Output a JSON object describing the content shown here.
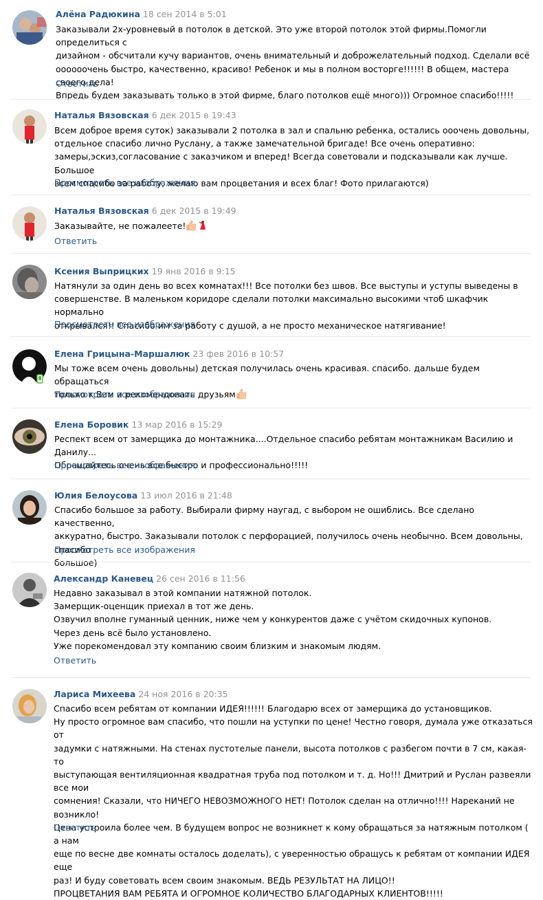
{
  "reviews": [
    {
      "author": "Алёна Радюкина",
      "date": "18 сен 2014 в 5:01",
      "lines": [
        "Заказывали 2х-уровневый в потолок в детской. Это уже второй потолок этой фирмы.Помогли определиться с",
        "дизайном - обсчитали кучу вариантов, очень внимательный и доброжелательный подход. Сделали всё",
        "оооооочень быстро, качественно, красиво! Ребенок и мы в полном восторге!!!!!! В общем, мастера своего дела!",
        "Впредь будем заказывать только в этой фирме, благо потолков ещё много))) Огромное спасибо!!!!!"
      ],
      "action": "Ответить"
    },
    {
      "author": "Наталья Вязовская",
      "date": "6 дек 2015 в 19:43",
      "lines": [
        "Всем доброе время суток) заказывали 2 потолка в зал и спальню ребенка, остались ооочень довольны,",
        "отдельное спасибо лично Руслану, а также замечательной бригаде! Все очень оперативно:",
        "замеры,эскиз,согласование с заказчиком и вперед! Всегда советовали и подсказывали как лучше. Большое",
        "всем спасибо за работу, желаю вам процветания и всех благ! Фото прилагаются)"
      ],
      "action": "Просмотреть все изображения"
    },
    {
      "author": "Наталья Вязовская",
      "date": "6 дек 2015 в 19:49",
      "lines": [
        "Заказывайте, не пожалеете!"
      ],
      "emojis": [
        "thumbs-up-emoji",
        "dancer-emoji"
      ],
      "action": "Ответить"
    },
    {
      "author": "Ксения Выприцких",
      "date": "19 янв 2016 в 9:15",
      "lines": [
        "Натянули за один день во всех комнатах!!! Все потолки без швов. Все выступы и уступы выведены в",
        "совершенстве. В маленьком коридоре сделали потолки максимально высокими чтоб шкафчик нормально",
        "открывался!! Спасибо им за работу с душой, а не просто механическое натягивание!"
      ],
      "action": "Просмотреть все изображения"
    },
    {
      "author": "Елена Грицына-Маршалюк",
      "date": "23 фев 2016 в 10:57",
      "lines": [
        "Мы тоже всем очень довольны) детская получилась очень красивая. спасибо. дальше будем обращаться",
        "только к Вам и рекомендовать друзьям"
      ],
      "emojis": [
        "thumbs-up-emoji"
      ],
      "action": "Просмотреть все изображения"
    },
    {
      "author": "Елена Боровик",
      "date": "13 мар 2016 в 15:29",
      "lines": [
        "Респект всем от замерщика до монтажника....Отдельное спасибо ребятам монтажникам Василию и Данилу...",
        "Обращайтесь очень все быстро и профессионально!!!!!"
      ],
      "action": "Просмотреть все изображения"
    },
    {
      "author": "Юлия Белоусова",
      "date": "13 июл 2016 в 21:48",
      "lines": [
        "Спасибо большое за работу. Выбирали фирму наугад, с выбором не ошиблись. Все сделано качественно,",
        "аккуратно, быстро. Заказывали потолок с перфорацией, получилось очень необычно. Всем довольны, спасибо",
        "большое)"
      ],
      "action": "Просмотреть все изображения"
    },
    {
      "author": "Александр Каневец",
      "date": "26 сен 2016 в 11:56",
      "lines": [
        "Недавно заказывал в этой компании натяжной потолок.",
        "Замерщик-оценщик приехал в тот же день.",
        "Озвучил вполне гуманный ценник, ниже чем у конкурентов даже с учётом скидочных купонов.",
        "Через день всё было установлено.",
        "Уже порекомендовал эту компанию своим близким и знакомым людям."
      ],
      "action": "Ответить"
    },
    {
      "author": "Лариса Михеева",
      "date": "24 ноя 2016 в 20:35",
      "lines": [
        "Спасибо всем ребятам от компании ИДЕЯ!!!!!! Благодарю всех от замерщика до установщиков.",
        "Ну просто огромное вам спасибо, что пошли на уступки по цене! Честно говоря, думала уже отказаться от",
        "задумки с натяжными. На стенах пустотелые панели, высота потолков с разбегом почти в 7 см, какая-то",
        "выступающая вентиляционная квадратная труба под потолком и т. д. Но!!! Дмитрий и Руслан развеяли все мои",
        "сомнения! Сказали, что НИЧЕГО НЕВОЗМОЖНОГО НЕТ! Потолок сделан на отлично!!!! Нареканий не возникло!",
        "Цена устроила более чем. В будущем вопрос не возникнет к кому обращаться за натяжным потолком ( а нам",
        "еще по весне две комнаты осталось доделать), с уверенностью обращусь к ребятам от компании ИДЕЯ еще",
        "раз! И буду советовать всем своим знакомым. ВЕДЬ РЕЗУЛЬТАТ НА ЛИЦО!!",
        "ПРОЦВЕТАНИЯ ВАМ РЕБЯТА И ОГРОМНОЕ КОЛИЧЕСТВО БЛАГОДАРНЫХ КЛИЕНТОВ!!!!!"
      ],
      "action": "Ответить"
    }
  ]
}
